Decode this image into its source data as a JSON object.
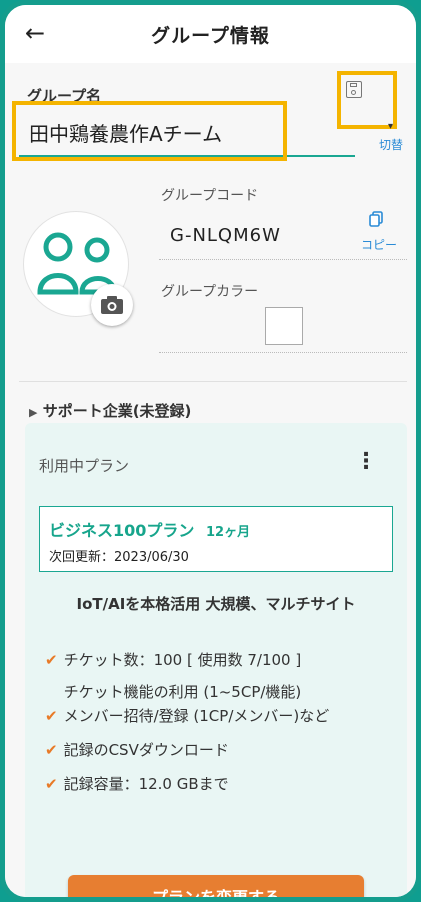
{
  "header": {
    "back_icon": "arrow-left-icon",
    "title": "グループ情報"
  },
  "group_name": {
    "label": "グループ名",
    "value": "田中鶏養農作Aチーム",
    "save_icon": "save-icon",
    "switch_label": "切替"
  },
  "group_code": {
    "label": "グループコード",
    "value": "G-NLQM6W",
    "copy_label": "コピー"
  },
  "group_color": {
    "label": "グループカラー",
    "value": "#ffffff"
  },
  "support": {
    "label": "サポート企業(未登録)"
  },
  "plan": {
    "heading": "利用中プラン",
    "name": "ビジネス100プラン",
    "term": "12ヶ月",
    "renewal": "次回更新：2023/06/30",
    "description": "IoT/AIを本格活用 大規模、マルチサイト",
    "features": [
      "チケット数：100 [ 使用数 7/100 ]",
      "チケット機能の利用 (1~5CP/機能)",
      "メンバー招待/登録 (1CP/メンバー)など",
      "記録のCSVダウンロード",
      "記録容量：12.0 GBまで"
    ],
    "cta": "プランを変更する"
  },
  "colors": {
    "accent": "#1aa792",
    "cta": "#e77e31",
    "highlight": "#f4b400",
    "link": "#2a8bd6"
  }
}
